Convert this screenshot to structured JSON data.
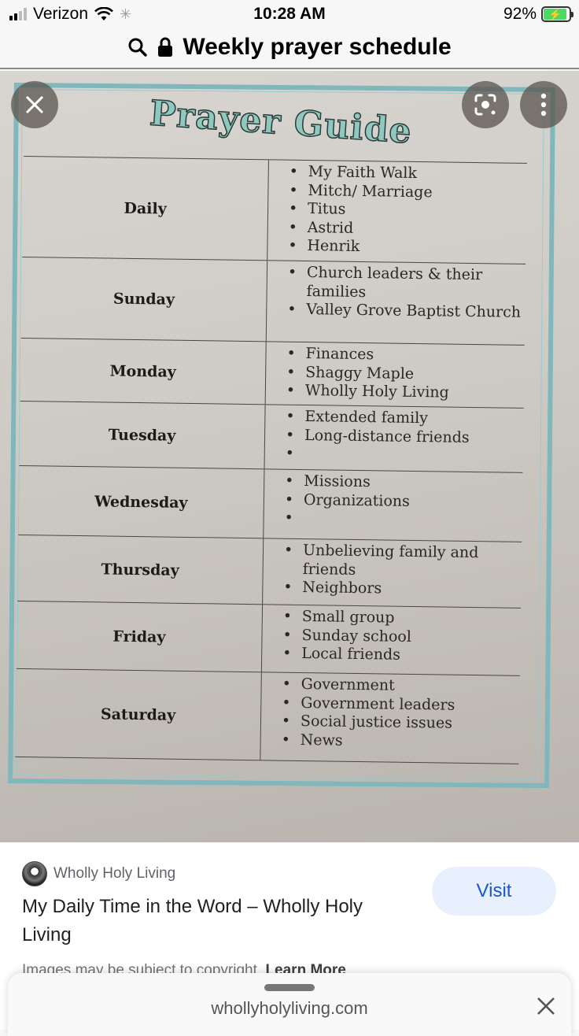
{
  "status_bar": {
    "carrier": "Verizon",
    "time": "10:28 AM",
    "battery": "92%",
    "battery_level_percent": 92,
    "icons": [
      "signal-icon",
      "wifi-icon",
      "activity-spinner-icon",
      "battery-charging-icon"
    ]
  },
  "title_bar": {
    "title": "Weekly prayer schedule",
    "icons": [
      "search-icon",
      "lock-icon"
    ]
  },
  "image": {
    "heading": "Prayer Guide",
    "rows": [
      {
        "day": "Daily",
        "items": [
          "My Faith Walk",
          "Mitch/ Marriage",
          "Titus",
          "Astrid",
          "Henrik"
        ]
      },
      {
        "day": "Sunday",
        "items": [
          "Church leaders & their families",
          "Valley Grove Baptist Church"
        ]
      },
      {
        "day": "Monday",
        "items": [
          "Finances",
          "Shaggy Maple",
          "Wholly Holy Living"
        ]
      },
      {
        "day": "Tuesday",
        "items": [
          "Extended family",
          "Long-distance friends",
          ""
        ]
      },
      {
        "day": "Wednesday",
        "items": [
          "Missions",
          "Organizations",
          ""
        ]
      },
      {
        "day": "Thursday",
        "items": [
          "Unbelieving family and friends",
          "Neighbors"
        ]
      },
      {
        "day": "Friday",
        "items": [
          "Small group",
          "Sunday school",
          "Local friends"
        ]
      },
      {
        "day": "Saturday",
        "items": [
          "Government",
          "Government leaders",
          "Social justice issues",
          "News"
        ]
      }
    ],
    "overlay_buttons": [
      "close-icon",
      "lens-search-icon",
      "more-options-icon"
    ]
  },
  "result": {
    "source_name": "Wholly Holy Living",
    "title": "My Daily Time in the Word – Wholly Holy Living",
    "visit_label": "Visit",
    "copyright_text": "Images may be subject to copyright.",
    "learn_more": "Learn More"
  },
  "bottom_sheet": {
    "url": "whollyholyliving.com"
  }
}
